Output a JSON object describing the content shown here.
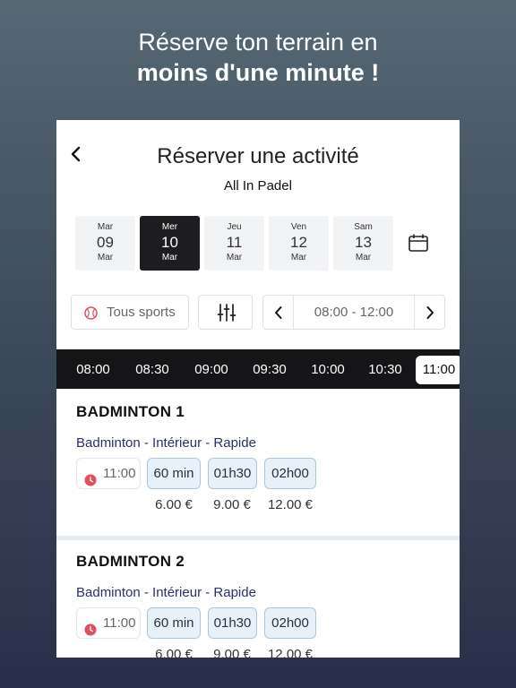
{
  "promo": {
    "line1": "Réserve ton terrain en",
    "line2": "moins d'une minute !"
  },
  "header": {
    "title": "Réserver une activité",
    "subtitle": "All In Padel"
  },
  "days": [
    {
      "name": "Mar",
      "num": "09",
      "month": "Mar",
      "selected": false
    },
    {
      "name": "Mer",
      "num": "10",
      "month": "Mar",
      "selected": true
    },
    {
      "name": "Jeu",
      "num": "11",
      "month": "Mar",
      "selected": false
    },
    {
      "name": "Ven",
      "num": "12",
      "month": "Mar",
      "selected": false
    },
    {
      "name": "Sam",
      "num": "13",
      "month": "Mar",
      "selected": false
    }
  ],
  "filters": {
    "sports_label": "Tous sports",
    "range_label": "08:00 - 12:00"
  },
  "timeslots": [
    "08:00",
    "08:30",
    "09:00",
    "09:30",
    "10:00",
    "10:30",
    "11:00"
  ],
  "selected_timeslot": "11:00",
  "courts": [
    {
      "name": "BADMINTON 1",
      "type": "Badminton - Intérieur  - Rapide",
      "time": "11:00",
      "durations": [
        "60 min",
        "01h30",
        "02h00"
      ],
      "prices": [
        "6.00 €",
        "9.00 €",
        "12.00 €"
      ]
    },
    {
      "name": "BADMINTON 2",
      "type": "Badminton - Intérieur  - Rapide",
      "time": "11:00",
      "durations": [
        "60 min",
        "01h30",
        "02h00"
      ],
      "prices": [
        "6.00 €",
        "9.00 €",
        "12.00 €"
      ]
    }
  ],
  "colors": {
    "accent_dark": "#1d1d1f",
    "type_text": "#2b2f6b",
    "clock_red": "#e0505c",
    "chip_border": "#a9c8de"
  },
  "icons": [
    "back-chevron-icon",
    "calendar-icon",
    "sport-ball-icon",
    "filter-sliders-icon",
    "chevron-left-icon",
    "chevron-right-icon",
    "clock-icon"
  ]
}
